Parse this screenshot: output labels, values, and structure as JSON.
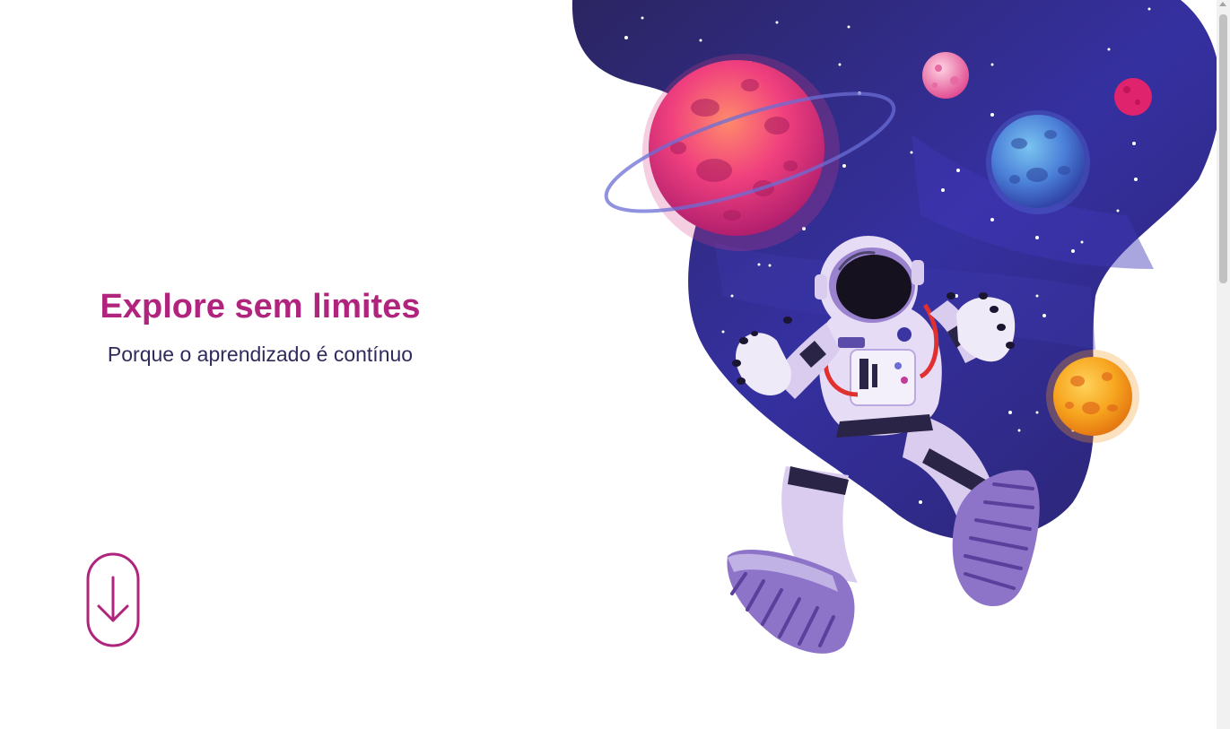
{
  "hero": {
    "title": "Explore sem limites",
    "subtitle": "Porque o aprendizado é contínuo"
  },
  "scroll_button": {
    "icon": "arrow-down-icon"
  },
  "illustration": {
    "subject": "astronaut-in-space-icon",
    "colors": {
      "space_dark": "#2d2770",
      "space_mid": "#3b35a3",
      "planet_pink": "#e83e8c",
      "planet_blue": "#4a7fd6",
      "planet_orange": "#f5a623",
      "suit": "#d9ccef",
      "suit_shadow": "#9a82cf"
    }
  },
  "theme": {
    "accent": "#b0247e",
    "text": "#2f2b5c"
  }
}
